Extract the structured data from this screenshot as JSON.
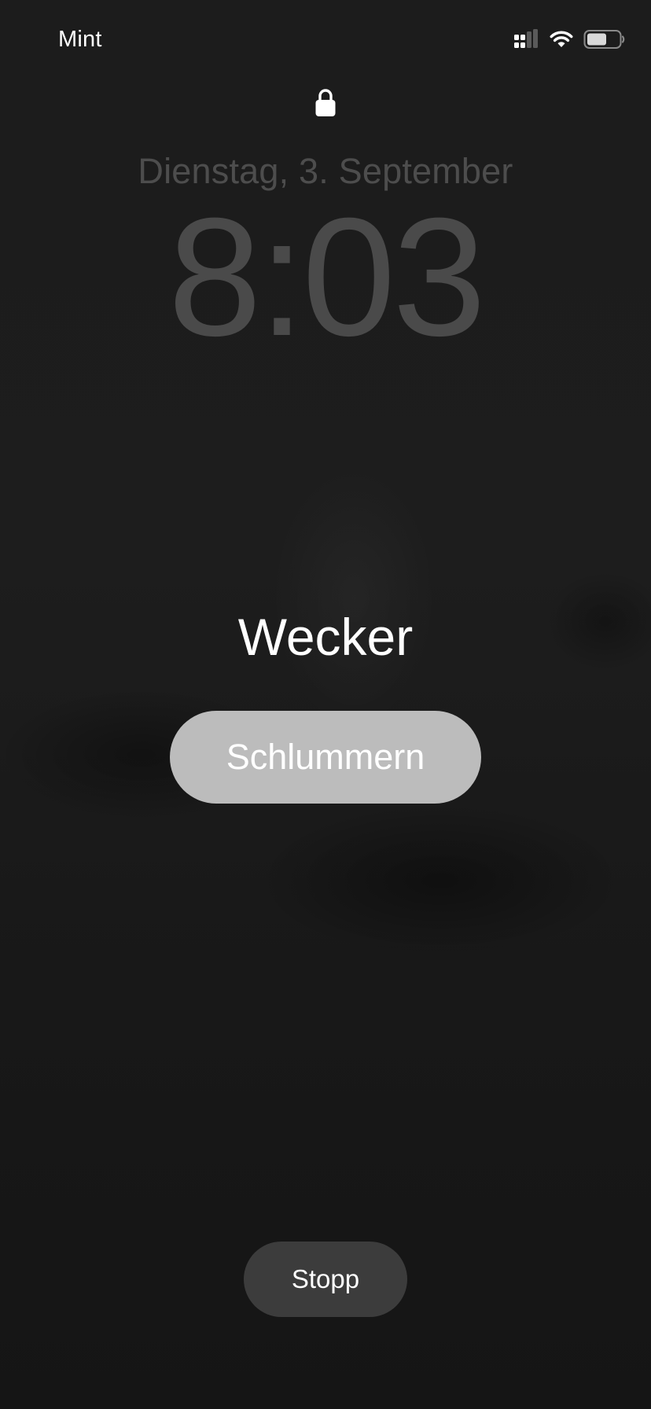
{
  "status_bar": {
    "carrier": "Mint",
    "icons": [
      "cellular-signal-icon",
      "wifi-icon",
      "battery-icon"
    ],
    "battery_level": 0.55
  },
  "lock_screen": {
    "lock_icon": "lock-icon",
    "date": "Dienstag, 3. September",
    "time": "8:03"
  },
  "alarm": {
    "title": "Wecker",
    "snooze_label": "Schlummern",
    "stop_label": "Stopp"
  },
  "colors": {
    "background": "#1b1b1b",
    "clock_text": "#4a4a4a",
    "snooze_button": "#bcbcbc",
    "stop_button": "#3c3c3c"
  }
}
